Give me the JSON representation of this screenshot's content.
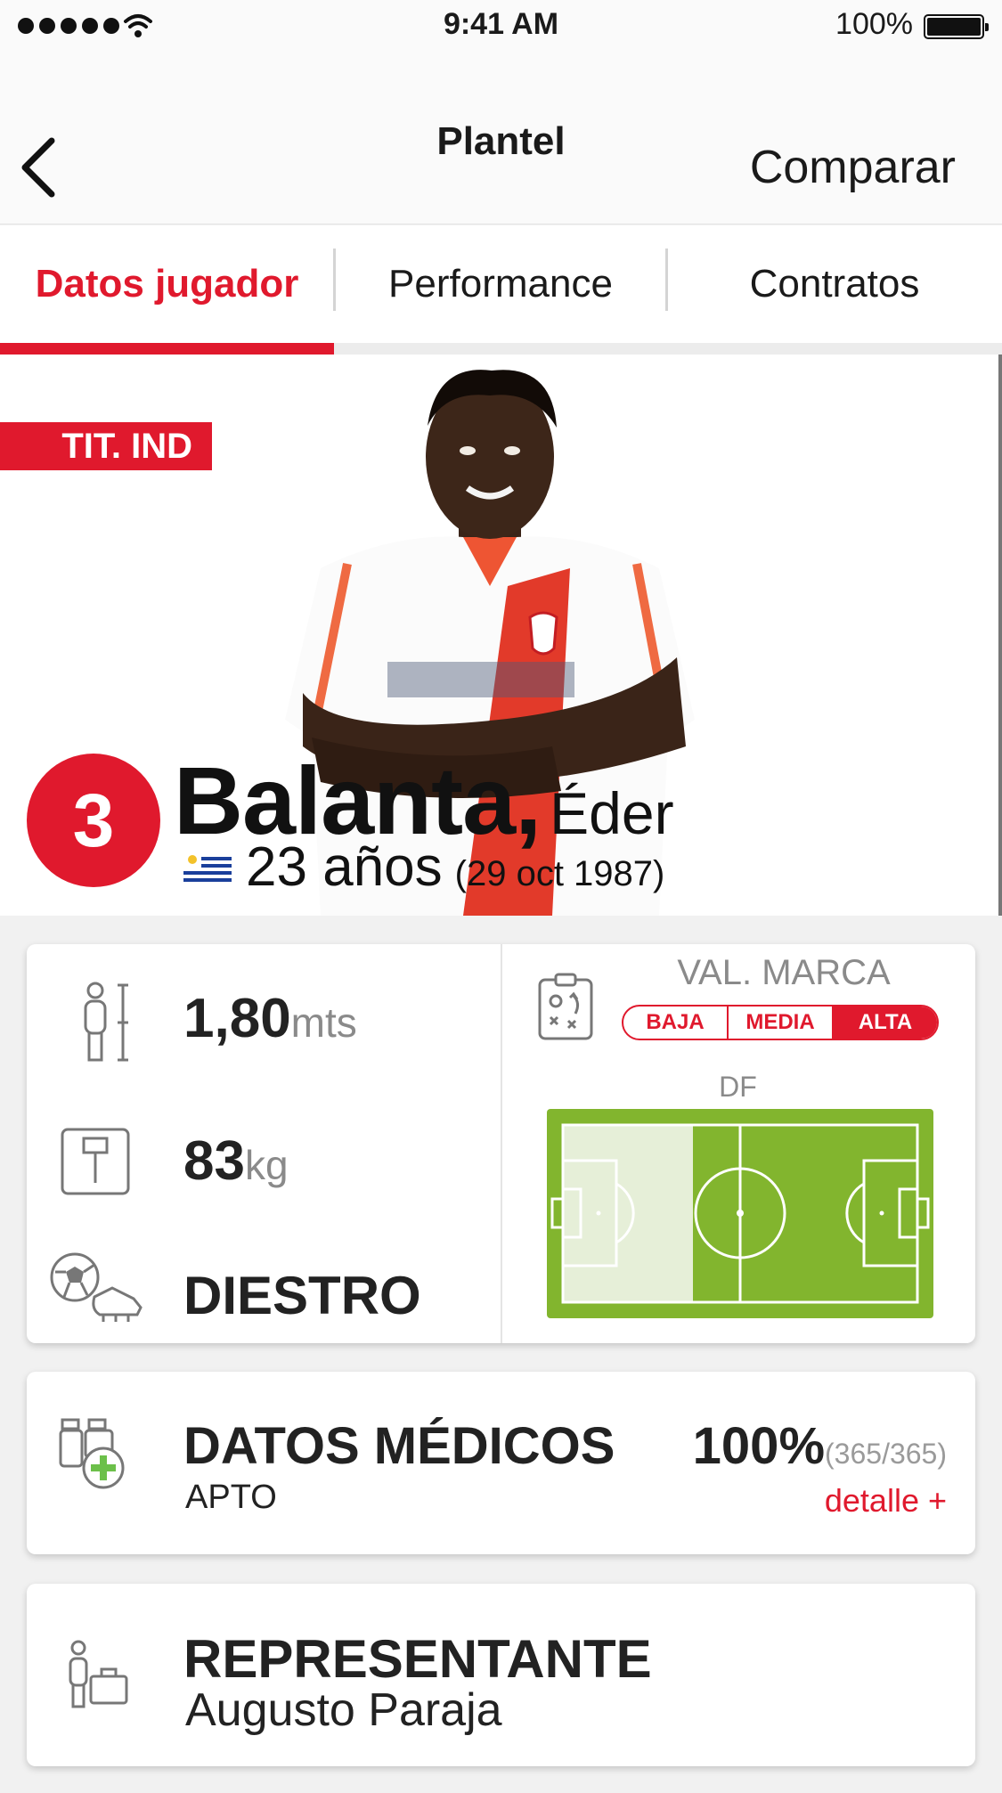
{
  "status_bar": {
    "time": "9:41 AM",
    "battery": "100%",
    "signal_icon": "signal-dots-icon",
    "wifi_icon": "wifi-icon",
    "battery_icon": "battery-icon"
  },
  "nav": {
    "title": "Plantel",
    "back_icon": "chevron-left-icon",
    "compare_label": "Comparar"
  },
  "tabs": [
    {
      "label": "Datos jugador",
      "active": true
    },
    {
      "label": "Performance",
      "active": false
    },
    {
      "label": "Contratos",
      "active": false
    }
  ],
  "player": {
    "status_badge": "TIT. IND",
    "number": "3",
    "surname": "Balanta,",
    "first_name": "Éder",
    "age": "23 años",
    "birth_date": "(29 oct 1987)",
    "nationality_icon": "uruguay-flag-icon"
  },
  "physical": {
    "height_value": "1,80",
    "height_unit": "mts",
    "weight_value": "83",
    "weight_unit": "kg",
    "foot": "DIESTRO"
  },
  "brand_value": {
    "label": "VAL. MARCA",
    "options": [
      "BAJA",
      "MEDIA",
      "ALTA"
    ],
    "selected": "ALTA"
  },
  "position": {
    "label": "DF",
    "highlighted_zone": "defensive third"
  },
  "medical": {
    "title": "DATOS MÉDICOS",
    "status": "APTO",
    "percentage": "100%",
    "fraction": "(365/365)",
    "detail_link": "detalle +"
  },
  "agent": {
    "title": "REPRESENTANTE",
    "name": "Augusto Paraja"
  },
  "colors": {
    "accent": "#e0192d",
    "pitch_green": "#82b52e",
    "pitch_highlight": "#e6efd8"
  }
}
